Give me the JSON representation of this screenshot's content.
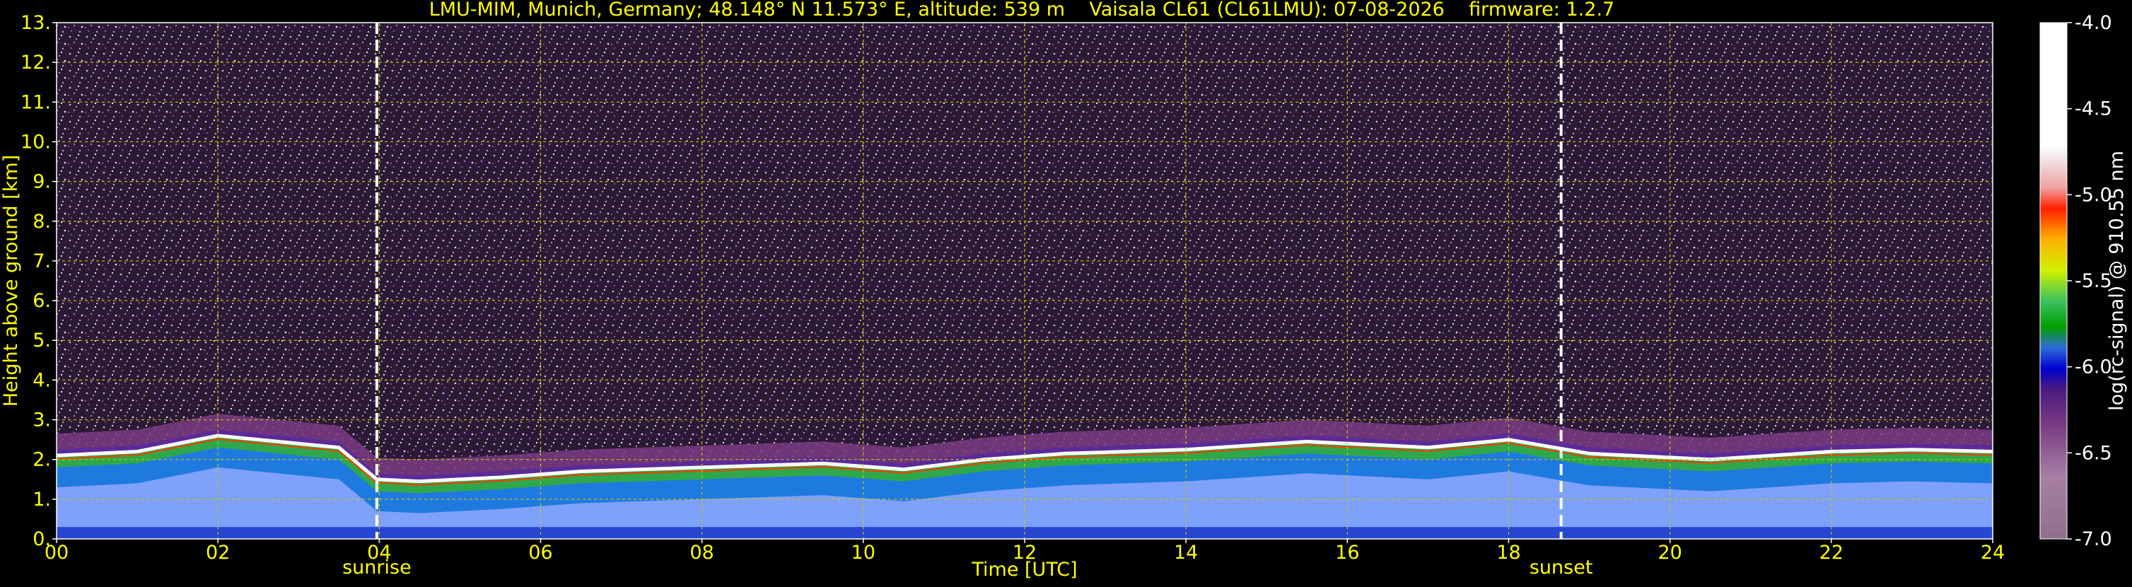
{
  "chart_data": {
    "type": "heatmap",
    "title": "LMU-MIM, Munich, Germany; 48.148° N 11.573° E, altitude: 539 m    Vaisala CL61 (CL61LMU): 07-08-2026    firmware: 1.2.7",
    "xlabel": "Time [UTC]",
    "ylabel": "Height above ground [km]",
    "xlim": [
      0,
      24
    ],
    "ylim": [
      0,
      13
    ],
    "x_ticks": [
      "00",
      "02",
      "04",
      "06",
      "08",
      "10",
      "12",
      "14",
      "16",
      "18",
      "20",
      "22",
      "24"
    ],
    "y_ticks": [
      "0.",
      "1.",
      "2.",
      "3.",
      "4.",
      "5.",
      "6.",
      "7.",
      "8.",
      "9.",
      "10.",
      "11.",
      "12.",
      "13."
    ],
    "grid": true,
    "colorbar": {
      "label": "log(rc-signal) @ 910.55 nm",
      "range": [
        -7.0,
        -4.0
      ],
      "ticks": [
        "-7.0",
        "-6.5",
        "-6.0",
        "-5.5",
        "-5.0",
        "-4.5",
        "-4.0"
      ]
    },
    "annotations": [
      {
        "label": "sunrise",
        "x": 3.97
      },
      {
        "label": "sunset",
        "x": 18.65
      }
    ],
    "cloud_top_km": [
      [
        0.0,
        2.1
      ],
      [
        1.0,
        2.2
      ],
      [
        2.0,
        2.6
      ],
      [
        3.0,
        2.4
      ],
      [
        3.5,
        2.3
      ],
      [
        3.97,
        1.5
      ],
      [
        4.5,
        1.45
      ],
      [
        5.5,
        1.55
      ],
      [
        6.5,
        1.7
      ],
      [
        8.0,
        1.8
      ],
      [
        9.5,
        1.9
      ],
      [
        10.5,
        1.75
      ],
      [
        11.5,
        2.0
      ],
      [
        12.5,
        2.15
      ],
      [
        14.0,
        2.25
      ],
      [
        15.5,
        2.45
      ],
      [
        17.0,
        2.3
      ],
      [
        18.0,
        2.5
      ],
      [
        19.0,
        2.15
      ],
      [
        20.5,
        2.0
      ],
      [
        22.0,
        2.2
      ],
      [
        23.0,
        2.25
      ],
      [
        24.0,
        2.2
      ]
    ]
  },
  "colors": {
    "text": "#ffff00",
    "grid": "#c8c800",
    "noise": "#2b1a33",
    "colorbar_label": "#ffffff"
  }
}
